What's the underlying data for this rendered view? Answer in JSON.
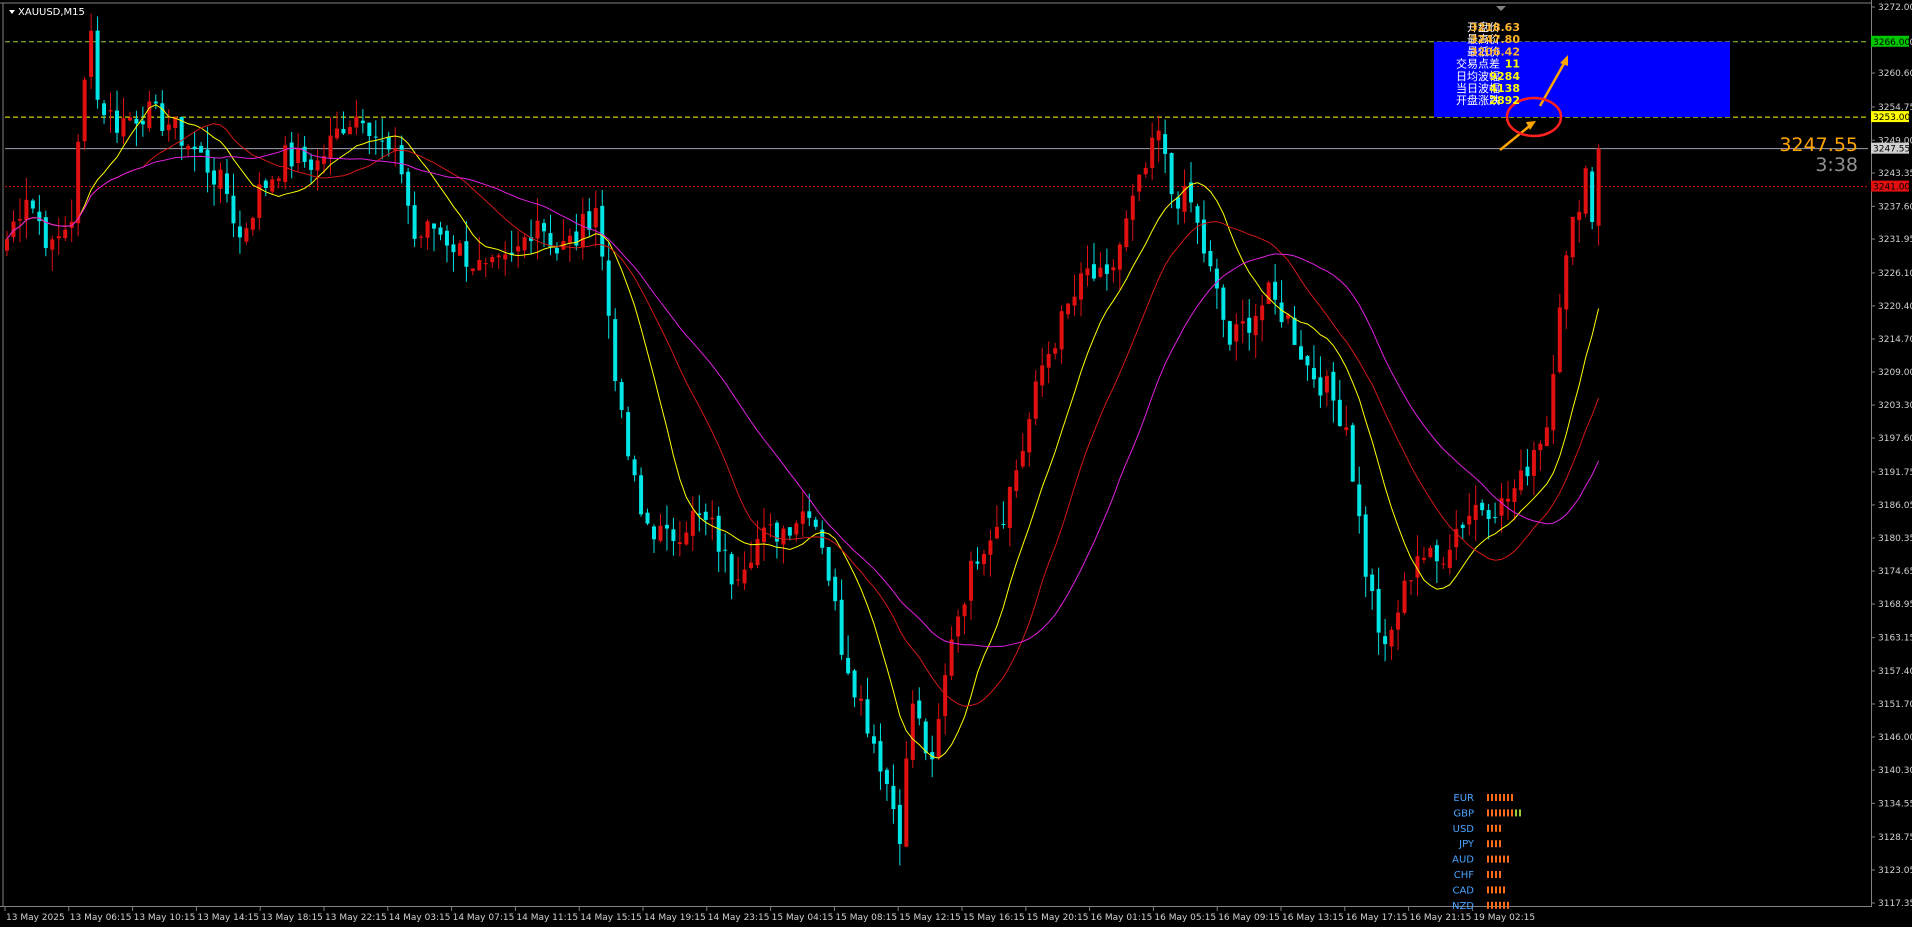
{
  "window": {
    "symbol_title": "XAUUSD,M15"
  },
  "info_panel": [
    {
      "label": "开盘价",
      "value": "3218.63",
      "color": "#ffb52e"
    },
    {
      "label": "最高价",
      "value": "3247.80",
      "color": "#ffb52e"
    },
    {
      "label": "最低价",
      "value": "3206.42",
      "color": "#ffb52e"
    },
    {
      "label": "交易点差",
      "value": "11",
      "color": "#ffff00"
    },
    {
      "label": "日均波幅",
      "value": "9284",
      "color": "#ffff00"
    },
    {
      "label": "当日波幅",
      "value": "4138",
      "color": "#ffff00"
    },
    {
      "label": "开盘涨跌",
      "value": "2892",
      "color": "#ffff00"
    }
  ],
  "current_price": {
    "value": "3247.55",
    "countdown": "3:38"
  },
  "currency_strength": [
    {
      "name": "EUR",
      "bars": 7
    },
    {
      "name": "GBP",
      "bars": 9
    },
    {
      "name": "USD",
      "bars": 4
    },
    {
      "name": "JPY",
      "bars": 4
    },
    {
      "name": "AUD",
      "bars": 6
    },
    {
      "name": "CHF",
      "bars": 4
    },
    {
      "name": "CAD",
      "bars": 5
    },
    {
      "name": "NZD",
      "bars": 6
    }
  ],
  "price_tags": [
    {
      "value": "3266.00",
      "color": "#00c800",
      "text_color": "#000000"
    },
    {
      "value": "3253.00",
      "color": "#ffff00",
      "text_color": "#000000"
    },
    {
      "value": "3247.55",
      "color": "#d0d0d0",
      "text_color": "#000000"
    },
    {
      "value": "3241.00",
      "color": "#e01010",
      "text_color": "#000000"
    }
  ],
  "chart_data": {
    "type": "candlestick",
    "symbol": "XAUUSD",
    "timeframe": "M15",
    "ylim": [
      3117.35,
      3272.0
    ],
    "y_ticks": [
      "3272.00",
      "3266.00",
      "3260.60",
      "3254.75",
      "3249.00",
      "3243.35",
      "3237.60",
      "3231.95",
      "3226.10",
      "3220.40",
      "3214.70",
      "3209.00",
      "3203.30",
      "3197.60",
      "3191.75",
      "3186.05",
      "3180.35",
      "3174.65",
      "3168.95",
      "3163.15",
      "3157.40",
      "3151.70",
      "3146.00",
      "3140.30",
      "3134.55",
      "3128.75",
      "3123.05",
      "3117.35"
    ],
    "x_ticks": [
      "13 May 2025",
      "13 May 06:15",
      "13 May 10:15",
      "13 May 14:15",
      "13 May 18:15",
      "13 May 22:15",
      "14 May 03:15",
      "14 May 07:15",
      "14 May 11:15",
      "14 May 15:15",
      "14 May 19:15",
      "14 May 23:15",
      "15 May 04:15",
      "15 May 08:15",
      "15 May 12:15",
      "15 May 16:15",
      "15 May 20:15",
      "16 May 01:15",
      "16 May 05:15",
      "16 May 09:15",
      "16 May 13:15",
      "16 May 17:15",
      "16 May 21:15",
      "19 May 02:15"
    ],
    "colors": {
      "bull": "#e01010",
      "bear": "#00e5e5"
    },
    "close_path": [
      [
        0,
        3232
      ],
      [
        3,
        3240
      ],
      [
        7,
        3230
      ],
      [
        10,
        3236
      ],
      [
        13,
        3270
      ],
      [
        14,
        3256
      ],
      [
        17,
        3252
      ],
      [
        21,
        3254
      ],
      [
        25,
        3252
      ],
      [
        30,
        3246
      ],
      [
        34,
        3240
      ],
      [
        36,
        3232
      ],
      [
        39,
        3240
      ],
      [
        43,
        3246
      ],
      [
        48,
        3245
      ],
      [
        52,
        3252
      ],
      [
        55,
        3254
      ],
      [
        58,
        3248
      ],
      [
        61,
        3244
      ],
      [
        63,
        3232
      ],
      [
        66,
        3234
      ],
      [
        70,
        3230
      ],
      [
        74,
        3226
      ],
      [
        78,
        3228
      ],
      [
        82,
        3236
      ],
      [
        85,
        3230
      ],
      [
        88,
        3232
      ],
      [
        91,
        3238
      ],
      [
        95,
        3200
      ],
      [
        98,
        3184
      ],
      [
        102,
        3180
      ],
      [
        106,
        3184
      ],
      [
        109,
        3182
      ],
      [
        112,
        3174
      ],
      [
        116,
        3180
      ],
      [
        120,
        3182
      ],
      [
        124,
        3186
      ],
      [
        126,
        3180
      ],
      [
        129,
        3162
      ],
      [
        132,
        3152
      ],
      [
        135,
        3142
      ],
      [
        138,
        3130
      ],
      [
        140,
        3152
      ],
      [
        143,
        3140
      ],
      [
        146,
        3164
      ],
      [
        150,
        3178
      ],
      [
        154,
        3185
      ],
      [
        157,
        3196
      ],
      [
        160,
        3210
      ],
      [
        164,
        3220
      ],
      [
        167,
        3226
      ],
      [
        170,
        3224
      ],
      [
        174,
        3238
      ],
      [
        178,
        3250
      ],
      [
        180,
        3240
      ],
      [
        183,
        3238
      ],
      [
        186,
        3226
      ],
      [
        189,
        3214
      ],
      [
        192,
        3218
      ],
      [
        195,
        3222
      ],
      [
        198,
        3218
      ],
      [
        201,
        3210
      ],
      [
        204,
        3206
      ],
      [
        207,
        3200
      ],
      [
        210,
        3175
      ],
      [
        213,
        3160
      ],
      [
        215,
        3168
      ],
      [
        218,
        3178
      ],
      [
        221,
        3176
      ],
      [
        224,
        3182
      ],
      [
        227,
        3186
      ],
      [
        231,
        3186
      ],
      [
        234,
        3190
      ],
      [
        236,
        3196
      ],
      [
        238,
        3200
      ],
      [
        240,
        3222
      ],
      [
        242,
        3234
      ],
      [
        244,
        3244
      ],
      [
        245,
        3236
      ],
      [
        246,
        3247.55
      ]
    ],
    "moving_averages": [
      {
        "period": "fast",
        "color": "#ffff00"
      },
      {
        "period": "medium",
        "color": "#d01818"
      },
      {
        "period": "slow",
        "color": "#e020e0"
      }
    ],
    "horizontal_levels": [
      {
        "value": 3266.0,
        "style": "dashed",
        "color": "#9acd32"
      },
      {
        "value": 3253.0,
        "style": "dashed",
        "color": "#ffff00"
      },
      {
        "value": 3247.55,
        "style": "solid",
        "color": "#a0a0b0"
      },
      {
        "value": 3241.0,
        "style": "dotted",
        "color": "#e01010"
      }
    ],
    "target_zone": {
      "from": 3253.0,
      "to": 3266.0,
      "color": "#0000ff"
    }
  }
}
